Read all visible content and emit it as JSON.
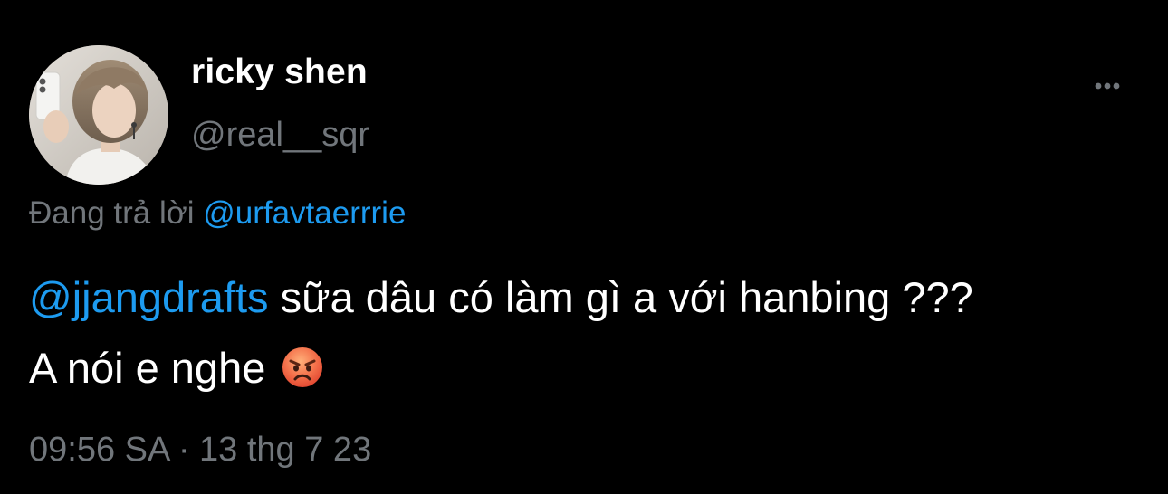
{
  "user": {
    "display_name": "ricky shen",
    "handle": "@real__sqr"
  },
  "reply_context": {
    "prefix": "Đang trả lời",
    "mention": "@urfavtaerrrie"
  },
  "tweet": {
    "mention": "@jjangdrafts",
    "line1_text": " sữa dâu có làm gì a với hanbing ???",
    "line2_text": "A nói e nghe ",
    "emoji": "angry-face-emoji"
  },
  "meta": {
    "time": "09:56 SA",
    "separator": "·",
    "date": "13 thg 7 23"
  },
  "icons": {
    "more": "more-horizontal-icon"
  },
  "colors": {
    "background": "#000000",
    "primary_text": "#ffffff",
    "secondary_text": "#71767b",
    "link": "#1d9bf0"
  }
}
